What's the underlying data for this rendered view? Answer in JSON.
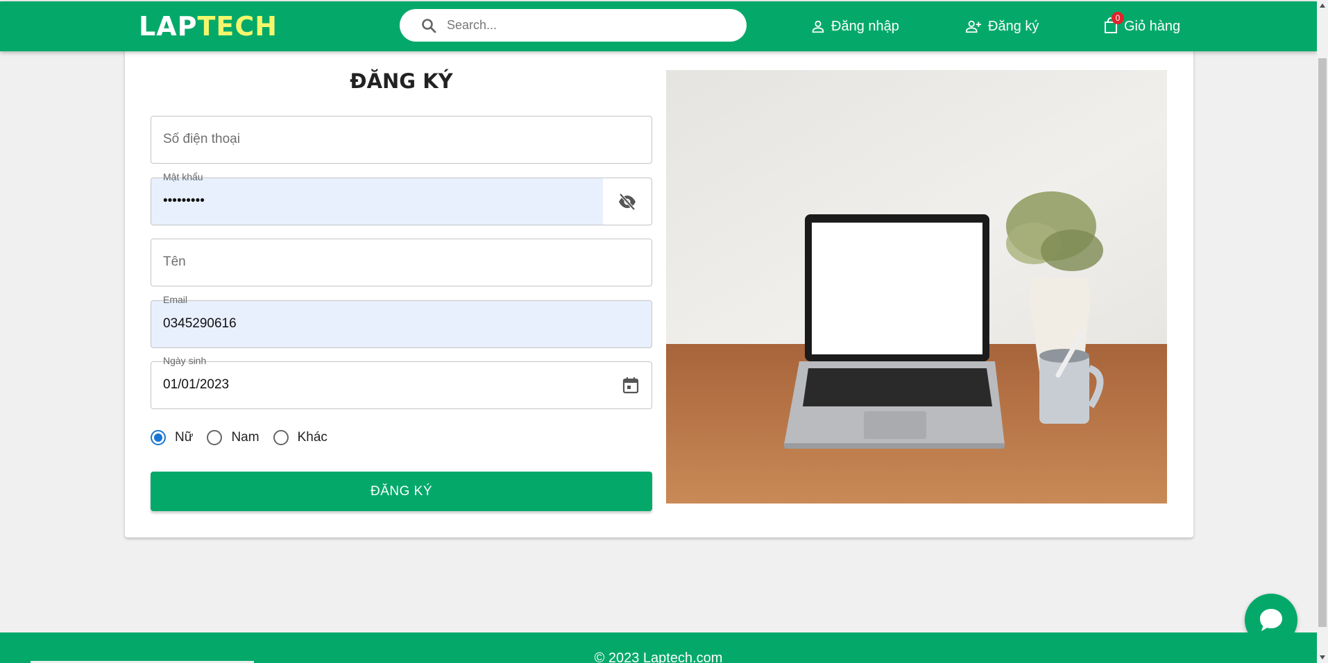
{
  "header": {
    "logo_part1": "LAP",
    "logo_part2": "TECH",
    "search_placeholder": "Search...",
    "login_label": "Đăng nhập",
    "register_label": "Đăng ký",
    "cart_label": "Giỏ hàng",
    "cart_count": "0"
  },
  "form": {
    "title": "ĐĂNG KÝ",
    "phone_placeholder": "Số điện thoại",
    "password_label": "Mật khẩu",
    "password_value": "•••••••••",
    "name_placeholder": "Tên",
    "email_label": "Email",
    "email_value": "0345290616",
    "dob_label": "Ngày sinh",
    "dob_value": "01/01/2023",
    "gender_options": [
      "Nữ",
      "Nam",
      "Khác"
    ],
    "gender_selected": "Nữ",
    "submit_label": "ĐĂNG KÝ"
  },
  "footer": {
    "copyright": "© 2023 Laptech.com"
  },
  "colors": {
    "brand_green": "#04a96a",
    "logo_accent": "#f4f76b",
    "badge_red": "#e0242b",
    "radio_blue": "#1976d2",
    "autofill_bg": "#e8f0fe"
  },
  "icons": {
    "search": "search-icon",
    "login": "person-icon",
    "register": "person-add-icon",
    "cart": "shopping-bag-icon",
    "password_toggle": "eye-off-icon",
    "calendar": "calendar-icon",
    "chat": "chat-bubble-icon"
  }
}
